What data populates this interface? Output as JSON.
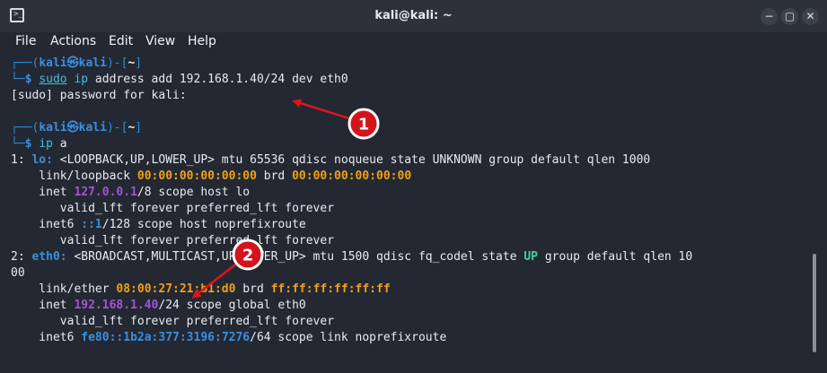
{
  "window": {
    "title": "kali@kali: ~",
    "buttons": {
      "minimize": "−",
      "maximize": "▢",
      "close": "✕"
    }
  },
  "menu": {
    "file": "File",
    "actions": "Actions",
    "edit": "Edit",
    "view": "View",
    "help": "Help"
  },
  "terminal": {
    "prompt1": {
      "open": "┌──(",
      "user": "kali",
      "at": "㉿",
      "host": "kali",
      "close": ")-[",
      "dir": "~",
      "end": "]"
    },
    "cmd1": {
      "corner": "└─",
      "dollar": "$ ",
      "sudo": "sudo",
      "rest1": " ",
      "ip": "ip",
      "rest2": " address add 192.168.1.40/24 dev eth0"
    },
    "sudo_prompt": "[sudo] password for kali:",
    "prompt2": {
      "open": "┌──(",
      "user": "kali",
      "at": "㉿",
      "host": "kali",
      "close": ")-[",
      "dir": "~",
      "end": "]"
    },
    "cmd2": {
      "corner": "└─",
      "dollar": "$ ",
      "ip": "ip",
      "rest": " a"
    },
    "lo": {
      "index": "1: ",
      "name": "lo:",
      "flags": " <LOOPBACK,UP,LOWER_UP> mtu 65536 qdisc noqueue state UNKNOWN group default qlen 1000",
      "link_pre": "    link/loopback ",
      "link_mac": "00:00:00:00:00:00",
      "link_mid": " brd ",
      "link_brd": "00:00:00:00:00:00",
      "inet_pre": "    inet ",
      "inet_addr": "127.0.0.1",
      "inet_post": "/8 scope host lo",
      "valid1": "       valid_lft forever preferred_lft forever",
      "inet6_pre": "    inet6 ",
      "inet6_addr": "::1",
      "inet6_post": "/128 scope host noprefixroute",
      "valid2": "       valid_lft forever preferred_lft forever"
    },
    "eth0": {
      "index": "2: ",
      "name": "eth0:",
      "flags_pre": " <BROADCAST,MULTICAST,UP,LOWER_UP> mtu 1500 qdisc fq_codel state ",
      "state": "UP",
      "flags_post": " group default qlen 10",
      "wrap": "00",
      "link_pre": "    link/ether ",
      "link_mac": "08:00:27:21:b1:d0",
      "link_mid": " brd ",
      "link_brd": "ff:ff:ff:ff:ff:ff",
      "inet_pre": "    inet ",
      "inet_addr": "192.168.1.40",
      "inet_post": "/24 scope global eth0",
      "valid1": "       valid_lft forever preferred_lft forever",
      "inet6_pre": "    inet6 ",
      "inet6_addr": "fe80::1b2a:377:3196:7276",
      "inet6_post": "/64 scope link noprefixroute"
    }
  },
  "annotations": {
    "badge1": "1",
    "badge2": "2"
  },
  "colors": {
    "arrow": "#e0141e",
    "badge_fill": "#d4141c",
    "badge_ring": "#ffffff"
  }
}
